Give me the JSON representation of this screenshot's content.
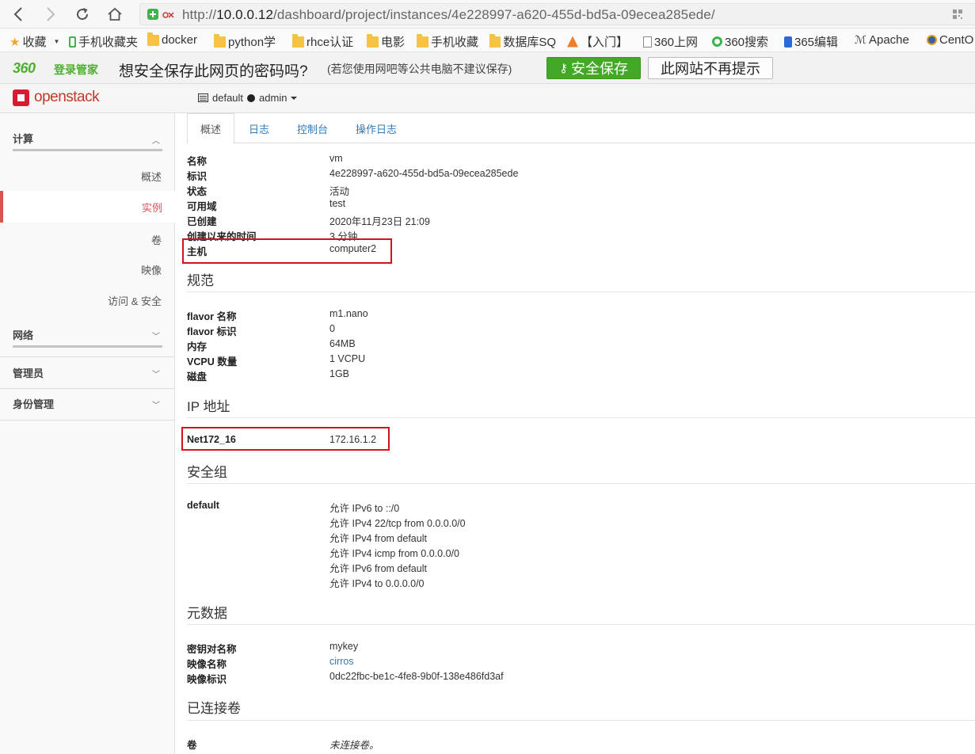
{
  "browser": {
    "url_prefix": "http://",
    "url_host": "10.0.0.12",
    "url_path": "/dashboard/project/instances/4e228997-a620-455d-bd5a-09ecea285ede/",
    "bookmarks": [
      {
        "label": "收藏",
        "icon": "star-icon"
      },
      {
        "label": "手机收藏夹",
        "icon": "phone-icon"
      },
      {
        "label": "docker",
        "icon": "folder-icon"
      },
      {
        "label": "python学",
        "icon": "folder-icon"
      },
      {
        "label": "rhce认证",
        "icon": "folder-icon"
      },
      {
        "label": "电影",
        "icon": "folder-icon"
      },
      {
        "label": "手机收藏",
        "icon": "folder-icon"
      },
      {
        "label": "数据库SQ",
        "icon": "folder-icon"
      },
      {
        "label": "【入门】",
        "icon": "site-icon"
      },
      {
        "label": "360上网",
        "icon": "page-icon"
      },
      {
        "label": "360搜索",
        "icon": "search-site-icon"
      },
      {
        "label": "365编辑",
        "icon": "site-icon"
      },
      {
        "label": "Apache",
        "icon": "feather-icon"
      },
      {
        "label": "CentO",
        "icon": "site-icon"
      }
    ]
  },
  "password_bar": {
    "logo": "360",
    "logo_sub": "登录管家",
    "question": "想安全保存此网页的密码吗?",
    "note": "(若您使用网吧等公共电脑不建议保存)",
    "save_label": "安全保存",
    "never_label": "此网站不再提示"
  },
  "header": {
    "logo_text": "openstack",
    "domain": "default",
    "project": "admin"
  },
  "sidebar": {
    "compute": "计算",
    "compute_items": [
      "概述",
      "实例",
      "卷",
      "映像",
      "访问 & 安全"
    ],
    "network": "网络",
    "admin": "管理员",
    "identity": "身份管理"
  },
  "tabs": [
    "概述",
    "日志",
    "控制台",
    "操作日志"
  ],
  "overview": [
    {
      "k": "名称",
      "v": "vm"
    },
    {
      "k": "标识",
      "v": "4e228997-a620-455d-bd5a-09ecea285ede"
    },
    {
      "k": "状态",
      "v": "活动"
    },
    {
      "k": "可用域",
      "v": "test"
    },
    {
      "k": "已创建",
      "v": "2020年11月23日 21:09"
    },
    {
      "k": "创建以来的时间",
      "v": "3 分钟"
    },
    {
      "k": "主机",
      "v": "computer2"
    }
  ],
  "spec_title": "规范",
  "spec": [
    {
      "k": "flavor 名称",
      "v": "m1.nano"
    },
    {
      "k": "flavor 标识",
      "v": "0"
    },
    {
      "k": "内存",
      "v": "64MB"
    },
    {
      "k": "VCPU 数量",
      "v": "1 VCPU"
    },
    {
      "k": "磁盘",
      "v": "1GB"
    }
  ],
  "ip_title": "IP 地址",
  "ip": [
    {
      "k": "Net172_16",
      "v": "172.16.1.2"
    }
  ],
  "secgroup_title": "安全组",
  "secgroup": {
    "name": "default",
    "rules": [
      "允许 IPv6 to ::/0",
      "允许 IPv4 22/tcp from 0.0.0.0/0",
      "允许 IPv4 from default",
      "允许 IPv4 icmp from 0.0.0.0/0",
      "允许 IPv6 from default",
      "允许 IPv4 to 0.0.0.0/0"
    ]
  },
  "meta_title": "元数据",
  "meta": [
    {
      "k": "密钥对名称",
      "v": "mykey"
    },
    {
      "k": "映像名称",
      "v": "cirros"
    },
    {
      "k": "映像标识",
      "v": "0dc22fbc-be1c-4fe8-9b0f-138e486fd3af"
    }
  ],
  "volumes_title": "已连接卷",
  "volumes": [
    {
      "k": "卷",
      "v": "未连接卷。"
    }
  ],
  "colors": {
    "accent": "#d9534f",
    "link": "#337ab7",
    "highlight": "#d0141e",
    "save_green": "#43a826"
  }
}
